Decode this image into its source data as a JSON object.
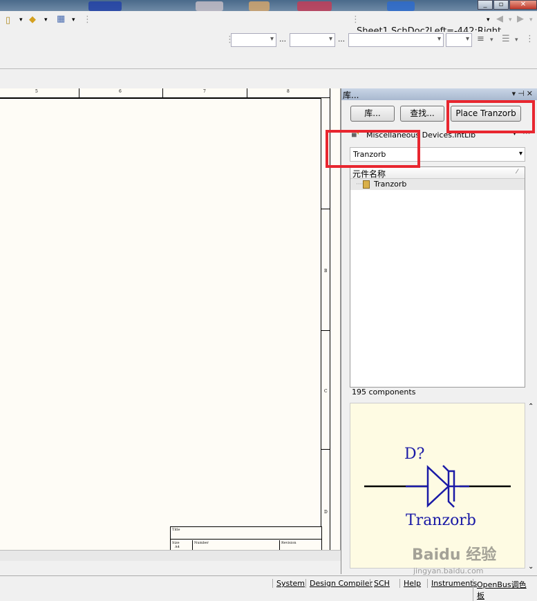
{
  "toolbar": {
    "document_path": "Sheet1.SchDoc?Left=-442;Right"
  },
  "schematic": {
    "top_ruler_labels": [
      "5",
      "6",
      "7",
      "8"
    ],
    "side_ruler_labels": [
      "B",
      "C",
      "D"
    ],
    "titleblock": {
      "title_label": "Title",
      "size_label": "Size",
      "size_value": "A4",
      "number_label": "Number",
      "revision_label": "Revision"
    }
  },
  "panel": {
    "title": "库...",
    "buttons": {
      "libraries": "库...",
      "search": "查找...",
      "place": "Place Tranzorb"
    },
    "library": "Miscellaneous Devices.IntLib",
    "filter": "Tranzorb",
    "list_header": "元件名称",
    "components": [
      {
        "name": "Tranzorb"
      }
    ],
    "count": "195 components",
    "preview": {
      "designator": "D?",
      "comment": "Tranzorb"
    }
  },
  "statusbar": {
    "items": [
      "System",
      "Design Compiler",
      "SCH",
      "Help",
      "Instruments",
      "OpenBus调色板"
    ]
  },
  "watermark": {
    "main": "Baidu 经验",
    "sub": "jingyan.baidu.com"
  },
  "colors": {
    "highlight": "#e8262f",
    "symbol": "#1a1aa6",
    "preview_bg": "#fefbe3"
  }
}
